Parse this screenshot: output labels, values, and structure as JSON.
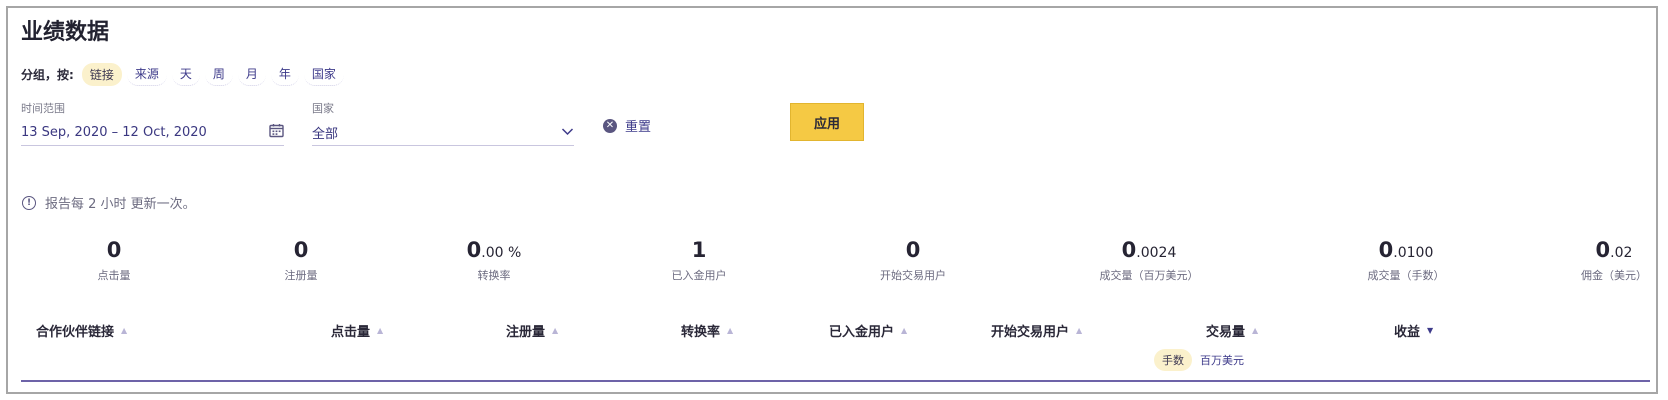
{
  "page": {
    "title": "业绩数据"
  },
  "group_by": {
    "label": "分组，按:",
    "options": [
      "链接",
      "来源",
      "天",
      "周",
      "月",
      "年",
      "国家"
    ],
    "selected": "链接"
  },
  "filters": {
    "date_range": {
      "label": "时间范围",
      "value": "13 Sep, 2020 – 12 Oct, 2020",
      "icon": "calendar-icon"
    },
    "country": {
      "label": "国家",
      "value": "全部",
      "icon": "chevron-down-icon"
    },
    "reset_label": "重置",
    "apply_label": "应用"
  },
  "notice": {
    "text": "报告每 2 小时 更新一次。",
    "icon": "info-icon"
  },
  "stats": [
    {
      "int": "0",
      "frac": "",
      "label": "点击量"
    },
    {
      "int": "0",
      "frac": "",
      "label": "注册量"
    },
    {
      "int": "0",
      "frac": ".00 %",
      "label": "转换率"
    },
    {
      "int": "1",
      "frac": "",
      "label": "已入金用户"
    },
    {
      "int": "0",
      "frac": "",
      "label": "开始交易用户"
    },
    {
      "int": "0",
      "frac": ".0024",
      "label": "成交量（百万美元）"
    },
    {
      "int": "0",
      "frac": ".0100",
      "label": "成交量（手数）"
    },
    {
      "int": "0",
      "frac": ".02",
      "label": "佣金（美元）"
    }
  ],
  "table": {
    "columns": [
      {
        "label": "合作伙伴链接",
        "sort": "asc"
      },
      {
        "label": "点击量",
        "sort": "asc"
      },
      {
        "label": "注册量",
        "sort": "asc"
      },
      {
        "label": "转换率",
        "sort": "asc"
      },
      {
        "label": "已入金用户",
        "sort": "asc"
      },
      {
        "label": "开始交易用户",
        "sort": "asc"
      },
      {
        "label": "交易量",
        "sort": "asc"
      },
      {
        "label": "收益",
        "sort": "desc"
      }
    ],
    "volume_units": [
      "手数",
      "百万美元"
    ],
    "volume_unit_selected": "手数"
  },
  "colors": {
    "accent": "#3d3a8a",
    "apply_button": "#f5c944",
    "chip_active": "#fbf1cc",
    "divider": "#6d63a8"
  }
}
